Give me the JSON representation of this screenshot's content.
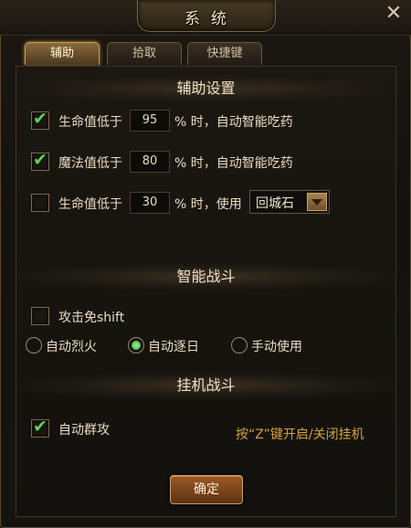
{
  "window": {
    "title": "系统",
    "close_symbol": "✕"
  },
  "tabs": [
    {
      "label": "辅助",
      "active": true
    },
    {
      "label": "拾取",
      "active": false
    },
    {
      "label": "快捷键",
      "active": false
    }
  ],
  "assist_settings": {
    "header": "辅助设置",
    "rows": [
      {
        "checked": true,
        "prefix": "生命值低于",
        "value": "95",
        "suffix": "% 时，自动智能吃药"
      },
      {
        "checked": true,
        "prefix": "魔法值低于",
        "value": "80",
        "suffix": "% 时，自动智能吃药"
      },
      {
        "checked": false,
        "prefix": "生命值低于",
        "value": "30",
        "suffix": "% 时，使用",
        "select_value": "回城石"
      }
    ]
  },
  "smart_combat": {
    "header": "智能战斗",
    "attack_shift": {
      "checked": false,
      "label": "攻击免shift"
    },
    "radios": [
      {
        "label": "自动烈火",
        "selected": false
      },
      {
        "label": "自动逐日",
        "selected": true
      },
      {
        "label": "手动使用",
        "selected": false
      }
    ]
  },
  "idle_combat": {
    "header": "挂机战斗",
    "group_attack": {
      "checked": true,
      "label": "自动群攻"
    },
    "hint": "按“Z”键开启/关闭挂机"
  },
  "confirm_label": "确定",
  "colors": {
    "accent": "#d4a13a",
    "check": "#5fd05a",
    "button": "#7a4420"
  }
}
